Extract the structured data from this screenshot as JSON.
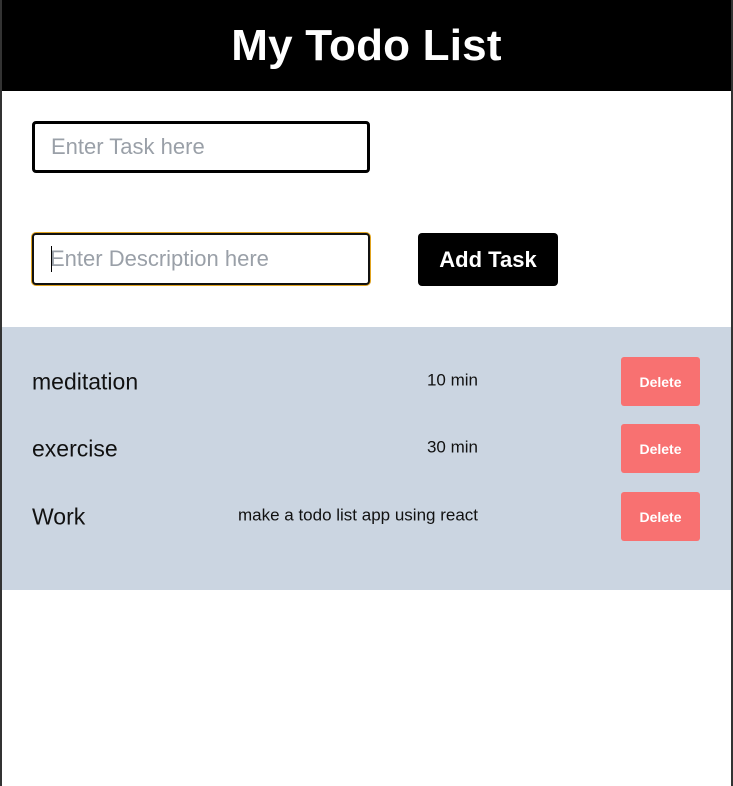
{
  "header": {
    "title": "My Todo List"
  },
  "form": {
    "task_placeholder": "Enter Task here",
    "task_value": "",
    "description_placeholder": "Enter Description here",
    "description_value": "",
    "add_button_label": "Add Task"
  },
  "todos": [
    {
      "name": "meditation",
      "description": "10 min",
      "delete_label": "Delete"
    },
    {
      "name": "exercise",
      "description": "30 min",
      "delete_label": "Delete"
    },
    {
      "name": "Work",
      "description": "make a todo list app using react",
      "delete_label": "Delete"
    }
  ],
  "colors": {
    "header_bg": "#000000",
    "list_bg": "#cbd5e1",
    "delete_bg": "#f87171",
    "focus_ring": "#e0a320"
  }
}
